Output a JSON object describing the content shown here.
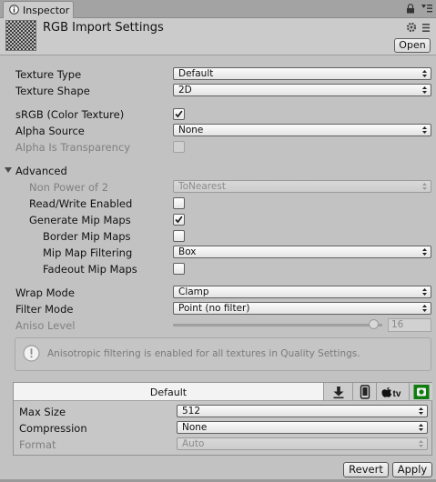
{
  "tab": {
    "label": "Inspector"
  },
  "header": {
    "title": "RGB Import Settings",
    "open_label": "Open"
  },
  "fields": {
    "texture_type": {
      "label": "Texture Type",
      "value": "Default"
    },
    "texture_shape": {
      "label": "Texture Shape",
      "value": "2D"
    },
    "srgb": {
      "label": "sRGB (Color Texture)",
      "checked": true
    },
    "alpha_source": {
      "label": "Alpha Source",
      "value": "None"
    },
    "alpha_transparency": {
      "label": "Alpha Is Transparency",
      "checked": false,
      "disabled": true
    }
  },
  "advanced": {
    "label": "Advanced",
    "non_power_of_2": {
      "label": "Non Power of 2",
      "value": "ToNearest",
      "disabled": true
    },
    "read_write": {
      "label": "Read/Write Enabled",
      "checked": false
    },
    "generate_mips": {
      "label": "Generate Mip Maps",
      "checked": true
    },
    "border_mips": {
      "label": "Border Mip Maps",
      "checked": false
    },
    "mip_filtering": {
      "label": "Mip Map Filtering",
      "value": "Box"
    },
    "fadeout_mips": {
      "label": "Fadeout Mip Maps",
      "checked": false
    }
  },
  "wrap_mode": {
    "label": "Wrap Mode",
    "value": "Clamp"
  },
  "filter_mode": {
    "label": "Filter Mode",
    "value": "Point (no filter)"
  },
  "aniso": {
    "label": "Aniso Level",
    "value": "16",
    "slider_fraction": 0.96,
    "disabled": true
  },
  "help": {
    "text": "Anisotropic filtering is enabled for all textures in Quality Settings."
  },
  "platform": {
    "tab_label": "Default",
    "icons": [
      "download-icon",
      "phone-icon",
      "apple-tv-icon",
      "xbox-icon"
    ],
    "apple_tv_text": "tv",
    "max_size": {
      "label": "Max Size",
      "value": "512"
    },
    "compression": {
      "label": "Compression",
      "value": "None"
    },
    "format": {
      "label": "Format",
      "value": "Auto",
      "disabled": true
    }
  },
  "buttons": {
    "revert": "Revert",
    "apply": "Apply"
  },
  "colors": {
    "background": "#c2c2c2",
    "xbox_green": "#107c10",
    "checkmark": "#1a1a1a"
  }
}
